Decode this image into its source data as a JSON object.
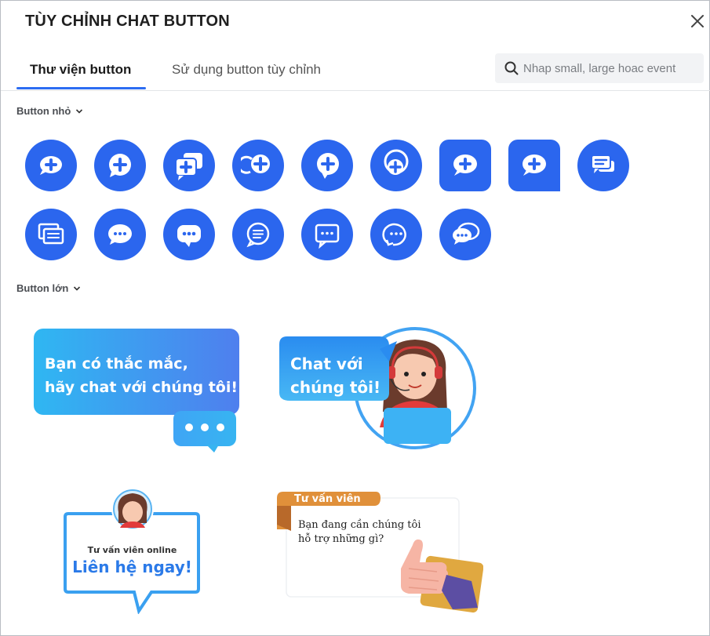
{
  "dialog": {
    "title": "TÙY CHỈNH CHAT BUTTON"
  },
  "tabs": [
    {
      "label": "Thư viện button",
      "active": true
    },
    {
      "label": "Sử dụng button tùy chỉnh",
      "active": false
    }
  ],
  "search": {
    "placeholder": "Nhap small, large hoac event"
  },
  "sections": {
    "small": {
      "label": "Button nhỏ"
    },
    "large": {
      "label": "Button lớn"
    }
  },
  "small_buttons": [
    "chat-plus-oval-icon",
    "chat-plus-round-icon",
    "chat-plus-stack-icon",
    "chat-plus-swirl-icon",
    "chat-plus-bubble-icon",
    "chat-plus-outline-icon",
    "chat-plus-square-icon",
    "chat-plus-tab-icon",
    "chat-lines-icon",
    "chat-multi-lines-icon",
    "chat-dots-round-icon",
    "chat-dots-square-icon",
    "chat-lines-outline-icon",
    "chat-dots-outline-icon",
    "chat-dots-swirl-icon",
    "chat-double-bubble-icon"
  ],
  "large_buttons": {
    "question": {
      "line1": "Bạn có thắc mắc,",
      "line2": "hãy chat với chúng tôi!"
    },
    "agent_chat": {
      "line1": "Chat với",
      "line2": "chúng tôi!"
    },
    "online": {
      "caption": "Tư vấn viên online",
      "cta": "Liên hệ ngay!"
    },
    "consultant": {
      "tag": "Tư vấn viên",
      "line1": "Bạn đang cần chúng tôi",
      "line2": "hỗ trợ những gì?"
    }
  },
  "colors": {
    "accent": "#2b66ee",
    "tab_underline": "#2d6df2",
    "orange": "#e0903a"
  }
}
